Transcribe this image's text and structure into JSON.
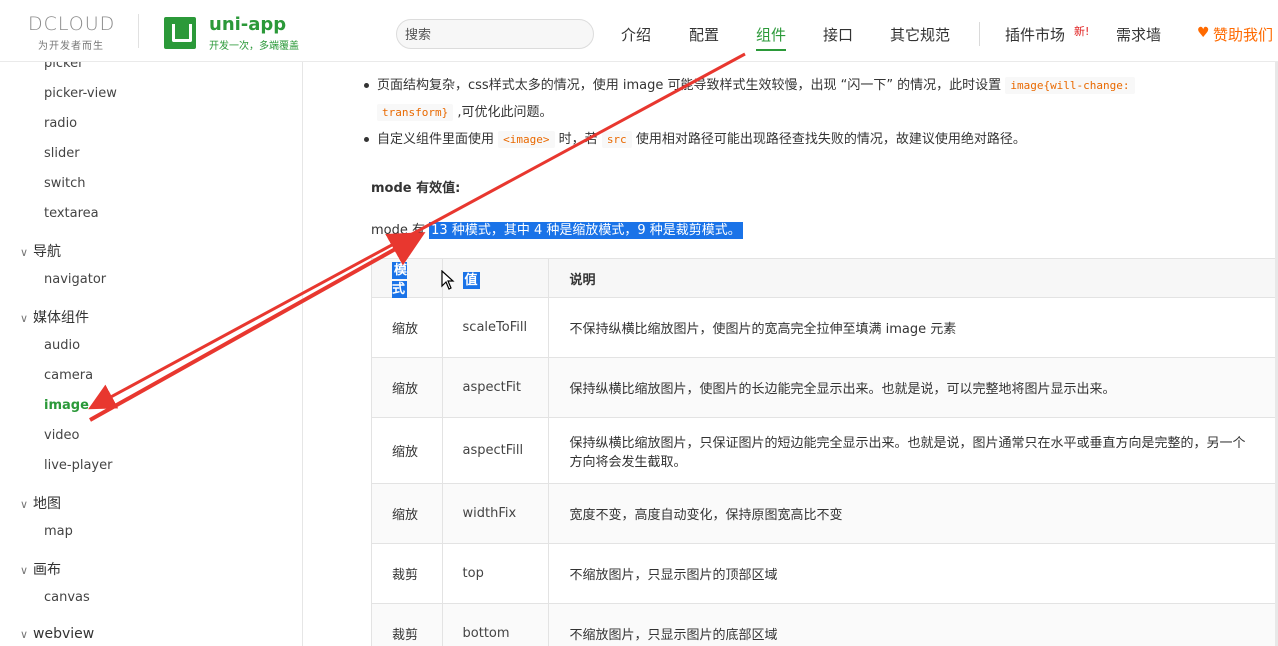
{
  "header": {
    "dcloud_logo": "DCLOUD",
    "dcloud_slogan": "为开发者而生",
    "app_title": "uni-app",
    "app_slogan": "开发一次，多端覆盖",
    "search_placeholder": "搜索",
    "nav": [
      "介绍",
      "配置",
      "组件",
      "接口",
      "其它规范",
      "插件市场",
      "需求墙",
      "赞助我们"
    ],
    "active_nav": "组件",
    "new_badge": "新!",
    "accent_color": "#2b9939",
    "sponsor_color": "#ff6a00"
  },
  "sidebar": {
    "items": [
      {
        "label": "picker",
        "type": "item"
      },
      {
        "label": "picker-view",
        "type": "item"
      },
      {
        "label": "radio",
        "type": "item"
      },
      {
        "label": "slider",
        "type": "item"
      },
      {
        "label": "switch",
        "type": "item"
      },
      {
        "label": "textarea",
        "type": "item"
      },
      {
        "label": "导航",
        "type": "group"
      },
      {
        "label": "navigator",
        "type": "item"
      },
      {
        "label": "媒体组件",
        "type": "group"
      },
      {
        "label": "audio",
        "type": "item"
      },
      {
        "label": "camera",
        "type": "item"
      },
      {
        "label": "image",
        "type": "item",
        "active": true
      },
      {
        "label": "video",
        "type": "item"
      },
      {
        "label": "live-player",
        "type": "item"
      },
      {
        "label": "地图",
        "type": "group"
      },
      {
        "label": "map",
        "type": "item"
      },
      {
        "label": "画布",
        "type": "group"
      },
      {
        "label": "canvas",
        "type": "item"
      },
      {
        "label": "webview",
        "type": "group"
      }
    ]
  },
  "content": {
    "bullets": [
      {
        "text_a": "页面结构复杂，css样式太多的情况，使用 image 可能导致样式生效较慢，出现 “闪一下” 的情况，此时设置",
        "code_a": "image{will-change:",
        "code_b": "transform}",
        "text_b": ",可优化此问题。"
      },
      {
        "text_a": "自定义组件里面使用",
        "code_a": "<image>",
        "text_b": "时，若",
        "code_b": "src",
        "text_c": "使用相对路径可能出现路径查找失败的情况，故建议使用绝对路径。"
      }
    ],
    "mode_heading": "mode 有效值:",
    "mode_intro_plain": "mode 有",
    "mode_intro_selected": "13 种模式，其中 4 种是缩放模式，9 种是裁剪模式。",
    "table": {
      "headers": [
        "模式",
        "值",
        "说明"
      ],
      "rows": [
        [
          "缩放",
          "scaleToFill",
          "不保持纵横比缩放图片，使图片的宽高完全拉伸至填满 image 元素"
        ],
        [
          "缩放",
          "aspectFit",
          "保持纵横比缩放图片，使图片的长边能完全显示出来。也就是说，可以完整地将图片显示出来。"
        ],
        [
          "缩放",
          "aspectFill",
          "保持纵横比缩放图片，只保证图片的短边能完全显示出来。也就是说，图片通常只在水平或垂直方向是完整的，另一个方向将会发生截取。"
        ],
        [
          "缩放",
          "widthFix",
          "宽度不变，高度自动变化，保持原图宽高比不变"
        ],
        [
          "裁剪",
          "top",
          "不缩放图片，只显示图片的顶部区域"
        ],
        [
          "裁剪",
          "bottom",
          "不缩放图片，只显示图片的底部区域"
        ]
      ]
    },
    "selection_color": "#1a73e8",
    "annotation_color": "#e8372f"
  }
}
